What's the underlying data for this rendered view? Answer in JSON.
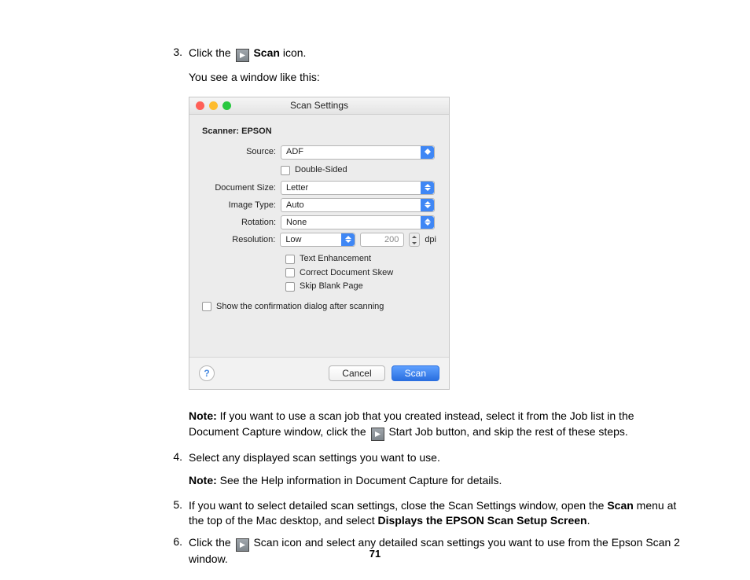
{
  "steps": {
    "threeA": "Click the",
    "threeB": "Scan",
    "threeC": " icon.",
    "threeSub": "You see a window like this:",
    "noteLabel": "Note:",
    "note3a": " If you want to use a scan job that you created instead, select it from the Job list in the Document Capture window, click the ",
    "note3b": " Start Job button, and skip the rest of these steps.",
    "four": "Select any displayed scan settings you want to use.",
    "note4": " See the Help information in Document Capture for details.",
    "five_a": "If you want to select detailed scan settings, close the Scan Settings window, open the ",
    "five_scan": "Scan",
    "five_b": " menu at the top of the Mac desktop, and select ",
    "five_disp": "Displays the EPSON Scan Setup Screen",
    "five_c": ".",
    "six_a": "Click the ",
    "six_b": " Scan icon and select any detailed scan settings you want to use from the Epson Scan 2 window."
  },
  "shot": {
    "title": "Scan Settings",
    "scannerLabel": "Scanner: EPSON",
    "labels": {
      "source": "Source:",
      "docsize": "Document Size:",
      "imgtype": "Image Type:",
      "rotation": "Rotation:",
      "resolution": "Resolution:"
    },
    "values": {
      "source": "ADF",
      "docsize": "Letter",
      "imgtype": "Auto",
      "rotation": "None",
      "resolution": "Low",
      "dpiValue": "200",
      "dpiUnit": "dpi"
    },
    "checks": {
      "double": "Double-Sided",
      "textEnh": "Text Enhancement",
      "skew": "Correct Document Skew",
      "blank": "Skip Blank Page",
      "confirm": "Show the confirmation dialog after scanning"
    },
    "buttons": {
      "cancel": "Cancel",
      "scan": "Scan"
    }
  },
  "pageNumber": "71",
  "nums": {
    "n3": "3.",
    "n4": "4.",
    "n5": "5.",
    "n6": "6."
  }
}
